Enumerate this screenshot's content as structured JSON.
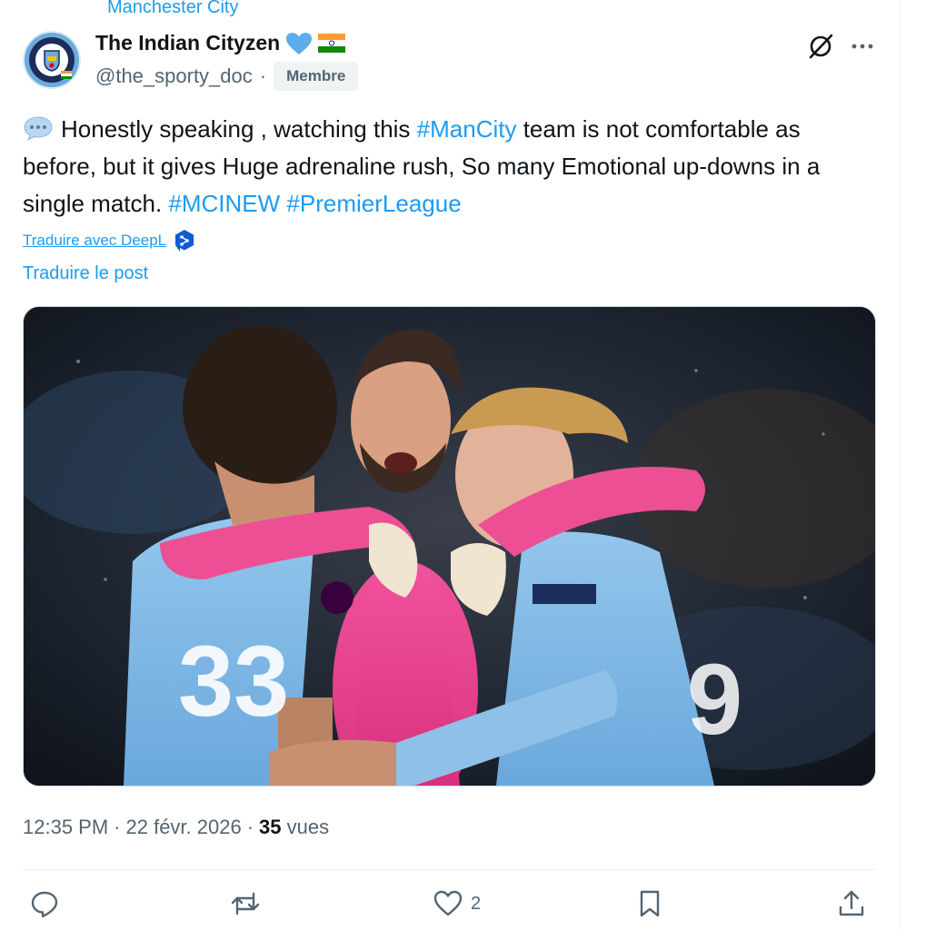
{
  "community": "Manchester City",
  "author": {
    "display_name": "The Indian Cityzen",
    "handle": "@the_sporty_doc",
    "separator": "·",
    "badge": "Membre",
    "avatar_icon": "manchester-city-crest"
  },
  "post": {
    "text_parts": [
      {
        "text": "Honestly speaking , watching this ",
        "hashtag": false
      },
      {
        "text": "#ManCity",
        "hashtag": true
      },
      {
        "text": " team is not comfortable as before, but it gives Huge adrenaline rush, So many Emotional up-downs  in a single match. ",
        "hashtag": false
      },
      {
        "text": "#MCINEW",
        "hashtag": true
      },
      {
        "text": " ",
        "hashtag": false
      },
      {
        "text": "#PremierLeague",
        "hashtag": true
      }
    ],
    "translate_deepl": "Traduire avec DeepL",
    "translate_post": "Traduire le post",
    "media_alt": "Manchester City players embracing goalkeeper in pink kit"
  },
  "meta": {
    "time": "12:35 PM",
    "dot1": "·",
    "date": "22 févr. 2026",
    "dot2": "·",
    "views_count": "35",
    "views_label": "vues"
  },
  "actions": {
    "reply_count": "",
    "repost_count": "",
    "like_count": "2",
    "bookmark_count": "",
    "share_count": ""
  },
  "colors": {
    "accent": "#1d9bf0",
    "secondary_text": "#536471",
    "primary_text": "#0f1419"
  }
}
